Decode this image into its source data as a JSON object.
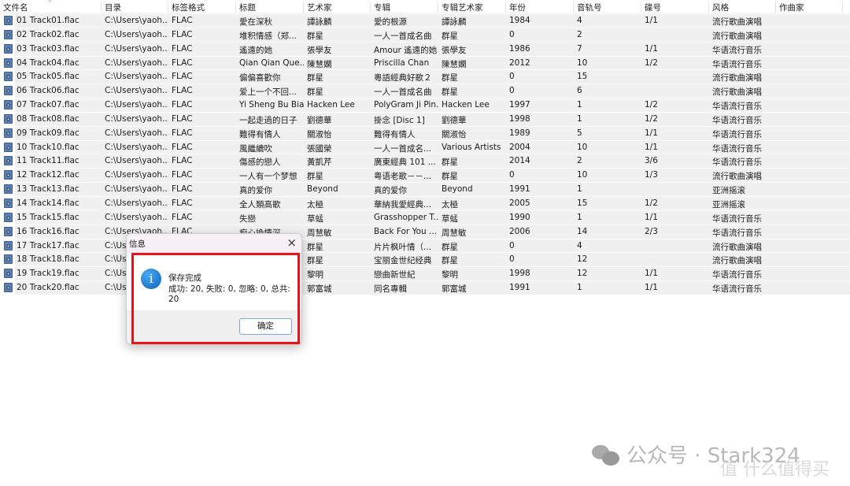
{
  "columns": [
    "文件名",
    "目录",
    "标签格式",
    "标题",
    "艺术家",
    "专辑",
    "专辑艺术家",
    "年份",
    "音轨号",
    "碟号",
    "风格",
    "作曲家"
  ],
  "rows": [
    [
      "01 Track01.flac",
      "C:\\Users\\yaoh...",
      "FLAC",
      "愛在深秋",
      "譚詠麟",
      "愛的根源",
      "譚詠麟",
      "1984",
      "4",
      "1/1",
      "流行歌曲演唱",
      ""
    ],
    [
      "02 Track02.flac",
      "C:\\Users\\yaoh...",
      "FLAC",
      "堆积情感（郑...",
      "群星",
      "一人一首成名曲",
      "群星",
      "0",
      "2",
      "",
      "流行歌曲演唱",
      ""
    ],
    [
      "03 Track03.flac",
      "C:\\Users\\yaoh...",
      "FLAC",
      "遙遠的她",
      "張學友",
      "Amour 遙遠的她",
      "張學友",
      "1986",
      "7",
      "1/1",
      "华语流行音乐",
      ""
    ],
    [
      "04 Track04.flac",
      "C:\\Users\\yaoh...",
      "FLAC",
      "Qian Qian Que...",
      "陳慧嫻",
      "Priscilla Chan",
      "陳慧嫻",
      "2012",
      "10",
      "1/2",
      "华语流行音乐",
      ""
    ],
    [
      "05 Track05.flac",
      "C:\\Users\\yaoh...",
      "FLAC",
      "偏偏喜歡你",
      "群星",
      "粵語經典好歌２",
      "群星",
      "0",
      "15",
      "",
      "流行歌曲演唱",
      ""
    ],
    [
      "06 Track06.flac",
      "C:\\Users\\yaoh...",
      "FLAC",
      "爱上一个不回...",
      "群星",
      "一人一首成名曲",
      "群星",
      "0",
      "6",
      "",
      "流行歌曲演唱",
      ""
    ],
    [
      "07 Track07.flac",
      "C:\\Users\\yaoh...",
      "FLAC",
      "Yi Sheng Bu Bian",
      "Hacken Lee",
      "PolyGram Ji Pin...",
      "Hacken Lee",
      "1997",
      "1",
      "1/2",
      "华语流行音乐",
      ""
    ],
    [
      "08 Track08.flac",
      "C:\\Users\\yaoh...",
      "FLAC",
      "一起走過的日子",
      "劉德華",
      "掛念 [Disc 1]",
      "劉德華",
      "1998",
      "1",
      "1/2",
      "华语流行音乐",
      ""
    ],
    [
      "09 Track09.flac",
      "C:\\Users\\yaoh...",
      "FLAC",
      "難得有情人",
      "關淑怡",
      "難得有情人",
      "關淑怡",
      "1989",
      "5",
      "1/1",
      "华语流行音乐",
      ""
    ],
    [
      "10 Track10.flac",
      "C:\\Users\\yaoh...",
      "FLAC",
      "風繼續吹",
      "張國榮",
      "一人一首成名...",
      "Various Artists",
      "2004",
      "10",
      "1/1",
      "华语流行音乐",
      ""
    ],
    [
      "11 Track11.flac",
      "C:\\Users\\yaoh...",
      "FLAC",
      "傷感的戀人",
      "黃凱芹",
      "廣東經典 101 ...",
      "群星",
      "2014",
      "2",
      "3/6",
      "华语流行音乐",
      ""
    ],
    [
      "12 Track12.flac",
      "C:\\Users\\yaoh...",
      "FLAC",
      "一人有一个梦想",
      "群星",
      "粤语老歌－－...",
      "群星",
      "0",
      "10",
      "1/3",
      "流行歌曲演唱",
      ""
    ],
    [
      "13 Track13.flac",
      "C:\\Users\\yaoh...",
      "FLAC",
      "真的爱你",
      "Beyond",
      "真的爱你",
      "Beyond",
      "1991",
      "1",
      "",
      "亚洲摇滚",
      ""
    ],
    [
      "14 Track14.flac",
      "C:\\Users\\yaoh...",
      "FLAC",
      "全人類高歌",
      "太極",
      "華納我愛經典...",
      "太極",
      "2005",
      "15",
      "1/2",
      "亚洲摇滚",
      ""
    ],
    [
      "15 Track15.flac",
      "C:\\Users\\yaoh...",
      "FLAC",
      "失戀",
      "草蜢",
      "Grasshopper T...",
      "草蜢",
      "1990",
      "1",
      "1/1",
      "华语流行音乐",
      ""
    ],
    [
      "16 Track16.flac",
      "C:\\Users\\yaoh...",
      "FLAC",
      "痴心換情深",
      "周慧敏",
      "Back For You ...",
      "周慧敏",
      "2006",
      "14",
      "2/3",
      "华语流行音乐",
      ""
    ],
    [
      "17 Track17.flac",
      "C:\\Use",
      "",
      "",
      "群星",
      "片片枫叶情（...",
      "群星",
      "0",
      "4",
      "",
      "流行歌曲演唱",
      ""
    ],
    [
      "18 Track18.flac",
      "C:\\Use",
      "",
      "",
      "群星",
      "宝丽金世纪经典",
      "群星",
      "0",
      "12",
      "",
      "流行歌曲演唱",
      ""
    ],
    [
      "19 Track19.flac",
      "C:\\Use",
      "",
      "",
      "黎明",
      "戀曲新世紀",
      "黎明",
      "1998",
      "12",
      "1/1",
      "华语流行音乐",
      ""
    ],
    [
      "20 Track20.flac",
      "C:\\Use",
      "",
      "",
      "郭富城",
      "同名專輯",
      "郭富城",
      "1991",
      "1",
      "1/1",
      "华语流行音乐",
      ""
    ]
  ],
  "dialog": {
    "title": "信息",
    "heading": "保存完成",
    "message": "成功: 20, 失败: 0, 忽略: 0, 总共: 20",
    "ok_label": "确定",
    "close_icon": "×",
    "info_icon": "i"
  },
  "watermark": {
    "text": "公众号 · Stark324",
    "site": "值 什么值得买"
  },
  "colors": {
    "row_bg": "#f0f0f0",
    "highlight": "#e8141c",
    "dialog_title_bg": "#f7eff6"
  }
}
